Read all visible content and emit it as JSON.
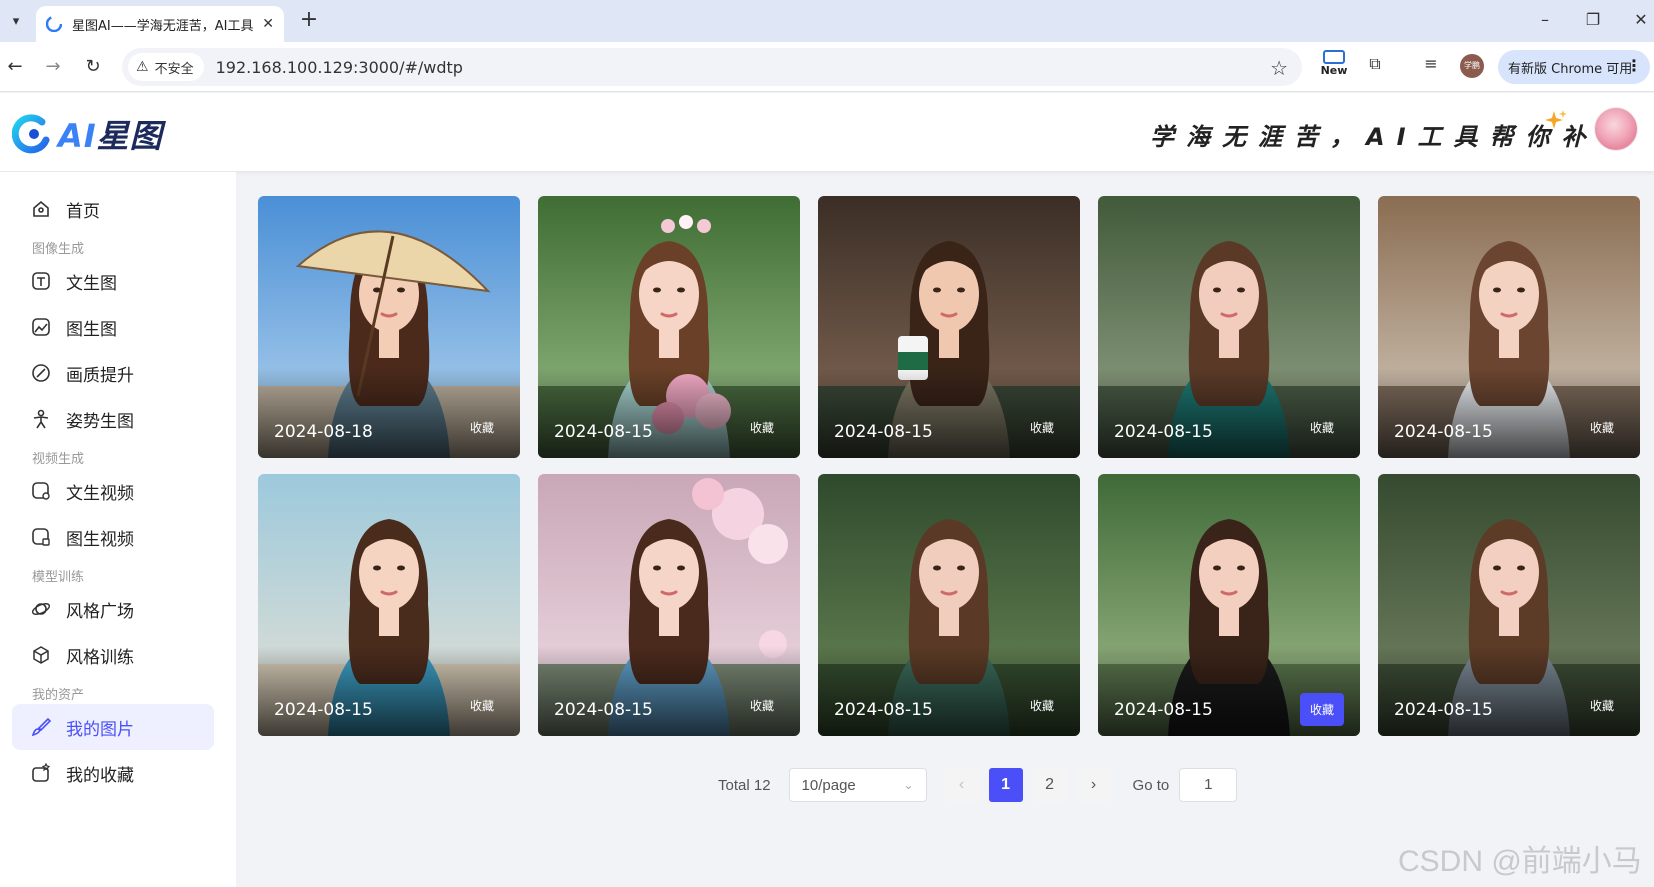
{
  "browser": {
    "tab_title": "星图AI——学海无涯苦，AI工具",
    "url": "192.168.100.129:3000/#/wdtp",
    "security_label": "不安全",
    "new_feature_label": "New",
    "update_label": "有新版 Chrome 可用",
    "profile_label": "学鹏"
  },
  "header": {
    "logo_ai": "AI",
    "logo_name": "星图",
    "slogan": "学海无涯苦，AI工具帮你补！"
  },
  "sidebar": {
    "home": "首页",
    "groups": {
      "image": "图像生成",
      "video": "视频生成",
      "model": "模型训练",
      "assets": "我的资产"
    },
    "items": {
      "text_to_image": "文生图",
      "image_to_image": "图生图",
      "upscale": "画质提升",
      "pose_to_image": "姿势生图",
      "text_to_video": "文生视频",
      "image_to_video": "图生视频",
      "style_square": "风格广场",
      "style_training": "风格训练",
      "my_images": "我的图片",
      "my_favorites": "我的收藏"
    }
  },
  "gallery": {
    "favorite_label": "收藏",
    "cards": [
      {
        "date": "2024-08-18",
        "favorited": false,
        "scene": "beach-umbrella"
      },
      {
        "date": "2024-08-15",
        "favorited": false,
        "scene": "garden-flowers"
      },
      {
        "date": "2024-08-15",
        "favorited": false,
        "scene": "cafe-coffee"
      },
      {
        "date": "2024-08-15",
        "favorited": false,
        "scene": "forest-teal-dress"
      },
      {
        "date": "2024-08-15",
        "favorited": false,
        "scene": "street-cafe"
      },
      {
        "date": "2024-08-15",
        "favorited": false,
        "scene": "beach-blue"
      },
      {
        "date": "2024-08-15",
        "favorited": false,
        "scene": "cherry-blossom"
      },
      {
        "date": "2024-08-15",
        "favorited": false,
        "scene": "forest-green"
      },
      {
        "date": "2024-08-15",
        "favorited": true,
        "scene": "garden-black-dress"
      },
      {
        "date": "2024-08-15",
        "favorited": false,
        "scene": "forest-grey"
      }
    ]
  },
  "pagination": {
    "total": "Total 12",
    "page_size": "10/page",
    "pages": [
      "1",
      "2"
    ],
    "current_page": "1",
    "goto_label": "Go to",
    "goto_value": "1",
    "prev": "‹",
    "next": "›"
  },
  "watermark": "CSDN @前端小马",
  "colors": {
    "accent": "#4b4ff7",
    "active_bg": "#eef0ff",
    "page_bg": "#f2f3f7"
  }
}
